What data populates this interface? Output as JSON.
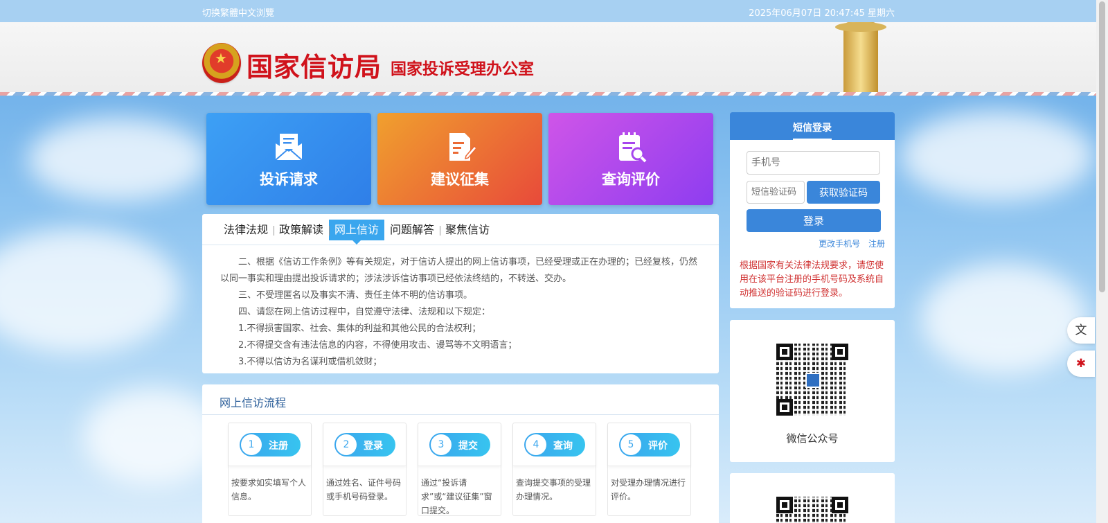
{
  "topbar": {
    "switch_label": "切换繁體中文浏覽",
    "datetime": "2025年06月07日  20:47:45  星期六"
  },
  "header": {
    "title_main": "国家信访局",
    "title_sub": "国家投诉受理办公室"
  },
  "cards": [
    {
      "label": "投诉请求",
      "icon": "envelope-icon"
    },
    {
      "label": "建议征集",
      "icon": "document-edit-icon"
    },
    {
      "label": "查询评价",
      "icon": "clipboard-search-icon"
    }
  ],
  "login": {
    "tab_label": "短信登录",
    "phone_placeholder": "手机号",
    "code_placeholder": "短信验证码",
    "get_code_label": "获取验证码",
    "login_label": "登录",
    "change_phone_label": "更改手机号",
    "register_label": "注册",
    "notice": "根据国家有关法律法规要求，请您使用在该平台注册的手机号码及系统自动推送的验证码进行登录。"
  },
  "qr": {
    "caption": "微信公众号"
  },
  "tabs": [
    "法律法规",
    "政策解读",
    "网上信访",
    "问题解答",
    "聚焦信访"
  ],
  "active_tab_index": 2,
  "info_paragraphs": [
    "二、根据《信访工作条例》等有关规定，对于信访人提出的网上信访事项，已经受理或正在办理的；已经复核，仍然以同一事实和理由提出投诉请求的；涉法涉诉信访事项已经依法终结的，不转送、交办。",
    "三、不受理匿名以及事实不清、责任主体不明的信访事项。",
    "四、请您在网上信访过程中，自觉遵守法律、法规和以下规定：",
    "1.不得损害国家、社会、集体的利益和其他公民的合法权利；",
    "2.不得提交含有违法信息的内容，不得使用攻击、谩骂等不文明语言；",
    "3.不得以信访为名谋利或借机敛财；"
  ],
  "process": {
    "title": "网上信访流程",
    "steps": [
      {
        "num": "1",
        "label": "注册",
        "desc": "按要求如实填写个人信息。"
      },
      {
        "num": "2",
        "label": "登录",
        "desc": "通过姓名、证件号码或手机号码登录。"
      },
      {
        "num": "3",
        "label": "提交",
        "desc": "通过“投诉请求”或“建议征集”窗口提交。"
      },
      {
        "num": "4",
        "label": "查询",
        "desc": "查询提交事项的受理办理情况。"
      },
      {
        "num": "5",
        "label": "评价",
        "desc": "对受理办理情况进行评价。"
      }
    ]
  },
  "colors": {
    "brand_red": "#d0121b",
    "primary_blue": "#3a86da",
    "tab_active": "#3aa6ee"
  }
}
